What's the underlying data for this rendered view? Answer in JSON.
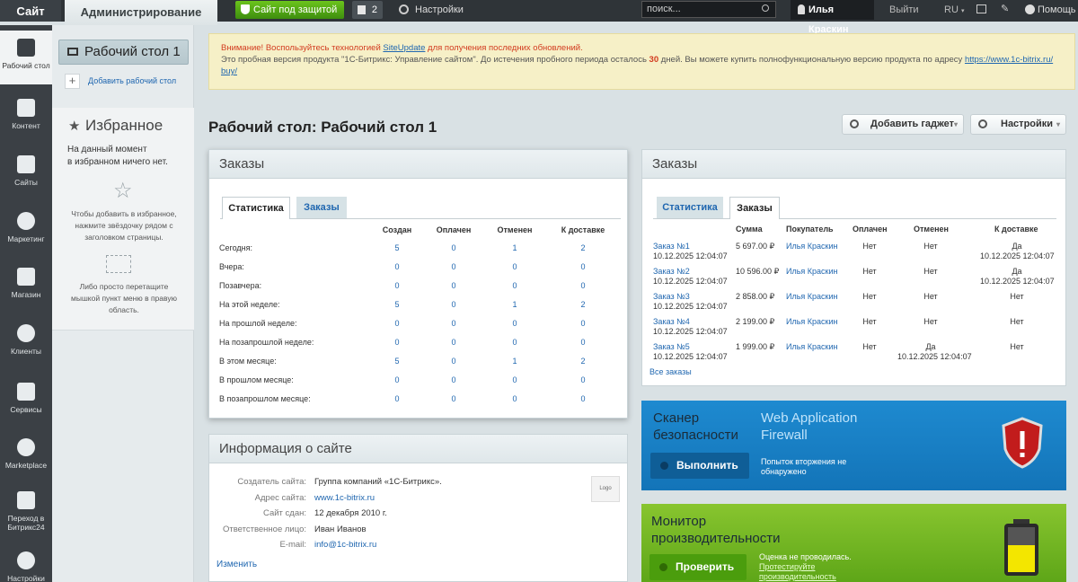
{
  "topbar": {
    "site": "Сайт",
    "admin": "Администрирование",
    "protected": "Сайт под защитой",
    "notes_count": "2",
    "settings": "Настройки",
    "search_placeholder": "поиск...",
    "user": "Илья Краскин",
    "logout": "Выйти",
    "lang": "RU",
    "help": "Помощь"
  },
  "nav": [
    {
      "label": "Рабочий стол",
      "icon": "home-icon"
    },
    {
      "label": "Контент",
      "icon": "content-icon"
    },
    {
      "label": "Сайты",
      "icon": "calendar-icon"
    },
    {
      "label": "Маркетинг",
      "icon": "target-icon"
    },
    {
      "label": "Магазин",
      "icon": "basket-icon"
    },
    {
      "label": "Клиенты",
      "icon": "clients-icon"
    },
    {
      "label": "Сервисы",
      "icon": "layers-icon"
    },
    {
      "label": "Marketplace",
      "icon": "cloud-icon"
    },
    {
      "label": "Переход в Битрикс24",
      "icon": "bitrix24-icon"
    },
    {
      "label": "Настройки",
      "icon": "gear-icon"
    }
  ],
  "left": {
    "desktop": "Рабочий стол 1",
    "add_desktop": "Добавить рабочий стол",
    "fav_title": "Избранное",
    "fav_empty_1": "На данный момент",
    "fav_empty_2": "в избранном ничего нет.",
    "fav_hint1": "Чтобы добавить в избранное, нажмите звёздочку рядом с заголовком страницы.",
    "fav_hint2": "Либо просто перетащите мышкой пункт меню в правую область."
  },
  "alert": {
    "p1": "Внимание! Воспользуйтесь технологией ",
    "link": "SiteUpdate",
    "p2": " для получения последних обновлений.",
    "l2a": "Это пробная версия продукта \"1С-Битрикс: Управление сайтом\". До истечения пробного периода осталось ",
    "days": "30",
    "l2b": " дней. Вы можете купить полнофункциональную версию продукта по адресу ",
    "url1": "https://www.1c-bitrix.ru/",
    "url2": "buy/"
  },
  "page": {
    "title": "Рабочий стол: Рабочий стол 1",
    "add_gadget": "Добавить гаджет",
    "settings": "Настройки"
  },
  "orders_stats": {
    "title": "Заказы",
    "tab_stats": "Статистика",
    "tab_orders": "Заказы",
    "headers": [
      "Создан",
      "Оплачен",
      "Отменен",
      "К доставке"
    ],
    "rows": [
      [
        "Сегодня:",
        "5",
        "0",
        "1",
        "2"
      ],
      [
        "Вчера:",
        "0",
        "0",
        "0",
        "0"
      ],
      [
        "Позавчера:",
        "0",
        "0",
        "0",
        "0"
      ],
      [
        "На этой неделе:",
        "5",
        "0",
        "1",
        "2"
      ],
      [
        "На прошлой неделе:",
        "0",
        "0",
        "0",
        "0"
      ],
      [
        "На позапрошлой неделе:",
        "0",
        "0",
        "0",
        "0"
      ],
      [
        "В этом месяце:",
        "5",
        "0",
        "1",
        "2"
      ],
      [
        "В прошлом месяце:",
        "0",
        "0",
        "0",
        "0"
      ],
      [
        "В позапрошлом месяце:",
        "0",
        "0",
        "0",
        "0"
      ]
    ]
  },
  "orders_list": {
    "title": "Заказы",
    "tab_stats": "Статистика",
    "tab_orders": "Заказы",
    "headers": [
      "Сумма",
      "Покупатель",
      "Оплачен",
      "Отменен",
      "К доставке"
    ],
    "rows": [
      {
        "order": "Заказ №1",
        "date": "10.12.2025 12:04:07",
        "sum": "5 697.00 ₽",
        "buyer": "Илья Краскин",
        "paid": "Нет",
        "canceled": "Нет",
        "canceled_date": "",
        "delivery": "Да",
        "delivery_date": "10.12.2025 12:04:07"
      },
      {
        "order": "Заказ №2",
        "date": "10.12.2025 12:04:07",
        "sum": "10 596.00 ₽",
        "buyer": "Илья Краскин",
        "paid": "Нет",
        "canceled": "Нет",
        "canceled_date": "",
        "delivery": "Да",
        "delivery_date": "10.12.2025 12:04:07"
      },
      {
        "order": "Заказ №3",
        "date": "10.12.2025 12:04:07",
        "sum": "2 858.00 ₽",
        "buyer": "Илья Краскин",
        "paid": "Нет",
        "canceled": "Нет",
        "canceled_date": "",
        "delivery": "Нет",
        "delivery_date": ""
      },
      {
        "order": "Заказ №4",
        "date": "10.12.2025 12:04:07",
        "sum": "2 199.00 ₽",
        "buyer": "Илья Краскин",
        "paid": "Нет",
        "canceled": "Нет",
        "canceled_date": "",
        "delivery": "Нет",
        "delivery_date": ""
      },
      {
        "order": "Заказ №5",
        "date": "10.12.2025 12:04:07",
        "sum": "1 999.00 ₽",
        "buyer": "Илья Краскин",
        "paid": "Нет",
        "canceled": "Да",
        "canceled_date": "10.12.2025 12:04:07",
        "delivery": "Нет",
        "delivery_date": ""
      }
    ],
    "all_orders": "Все заказы"
  },
  "info": {
    "title": "Информация о сайте",
    "rows": [
      {
        "label": "Создатель сайта:",
        "value": "Группа компаний «1С-Битрикс»."
      },
      {
        "label": "Адрес сайта:",
        "value": "www.1c-bitrix.ru"
      },
      {
        "label": "Сайт сдан:",
        "value": "12 декабря 2010 г."
      },
      {
        "label": "Ответственное лицо:",
        "value": "Иван Иванов"
      },
      {
        "label": "E-mail:",
        "value": "info@1c-bitrix.ru"
      }
    ],
    "logo": "Logo",
    "edit": "Изменить"
  },
  "scanner": {
    "title1": "Сканер",
    "title2": "безопасности",
    "sub1": "Web Application",
    "sub2": "Firewall",
    "button": "Выполнить",
    "note1": "Попыток вторжения не",
    "note2": "обнаружено"
  },
  "perf": {
    "title1": "Монитор",
    "title2": "производительности",
    "button": "Проверить",
    "note1": "Оценка не проводилась.",
    "note2": "Протестируйте",
    "note3": "производительность"
  }
}
